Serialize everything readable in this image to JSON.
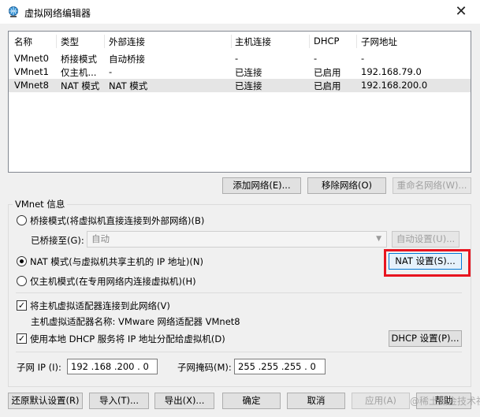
{
  "window": {
    "title": "虚拟网络编辑器",
    "close_glyph": "✕",
    "icon": "network-globe-icon"
  },
  "table": {
    "headers": [
      "名称",
      "类型",
      "外部连接",
      "主机连接",
      "DHCP",
      "子网地址"
    ],
    "rows": [
      [
        "VMnet0",
        "桥接模式",
        "自动桥接",
        "-",
        "-",
        "-"
      ],
      [
        "VMnet1",
        "仅主机...",
        "-",
        "已连接",
        "已启用",
        "192.168.79.0"
      ],
      [
        "VMnet8",
        "NAT 模式",
        "NAT 模式",
        "已连接",
        "已启用",
        "192.168.200.0"
      ]
    ],
    "selected_row": 2
  },
  "list_buttons": {
    "add": "添加网络(E)...",
    "remove": "移除网络(O)",
    "rename": "重命名网络(W)..."
  },
  "vmnet_info": {
    "group_label": "VMnet 信息",
    "bridged_label": "桥接模式(将虚拟机直接连接到外部网络)(B)",
    "bridged_to_label": "已桥接至(G):",
    "bridged_to_value": "自动",
    "auto_settings": "自动设置(U)...",
    "nat_label": "NAT 模式(与虚拟机共享主机的 IP 地址)(N)",
    "nat_settings": "NAT 设置(S)...",
    "hostonly_label": "仅主机模式(在专用网络内连接虚拟机)(H)",
    "connect_adapter_label": "将主机虚拟适配器连接到此网络(V)",
    "adapter_name_text": "主机虚拟适配器名称: VMware 网络适配器 VMnet8",
    "dhcp_label": "使用本地 DHCP 服务将 IP 地址分配给虚拟机(D)",
    "dhcp_settings": "DHCP 设置(P)...",
    "subnet_ip_label": "子网 IP (I):",
    "subnet_ip_value": "192 .168 .200 . 0",
    "subnet_mask_label": "子网掩码(M):",
    "subnet_mask_value": "255 .255 .255 . 0",
    "mode_selected": "nat",
    "connect_adapter_checked": true,
    "dhcp_checked": true
  },
  "footer": {
    "restore": "还原默认设置(R)",
    "import": "导入(T)...",
    "export": "导出(X)...",
    "ok": "确定",
    "cancel": "取消",
    "apply": "应用(A)",
    "help": "帮助"
  },
  "watermark": "@稀土掘金技术社区",
  "colors": {
    "highlight": "#e8141f",
    "selected_row": "#e5e5e5"
  }
}
